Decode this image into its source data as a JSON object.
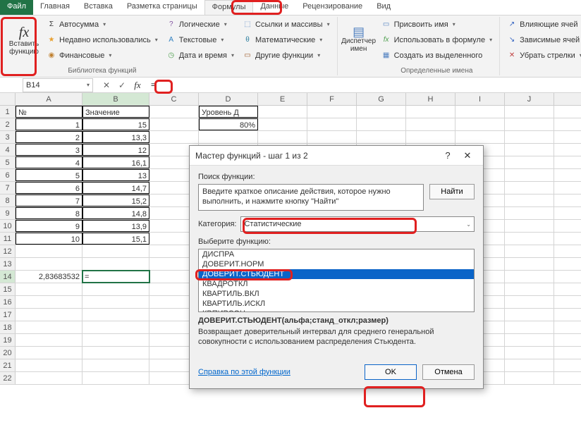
{
  "tabs": {
    "file": "Файл",
    "home": "Главная",
    "insert": "Вставка",
    "layout": "Разметка страницы",
    "formulas": "Формулы",
    "data": "Данные",
    "review": "Рецензирование",
    "view": "Вид"
  },
  "ribbon": {
    "insert_fn_label": "Вставить функцию",
    "autosum": "Автосумма",
    "recent": "Недавно использовались",
    "financial": "Финансовые",
    "logical": "Логические",
    "text": "Текстовые",
    "datetime": "Дата и время",
    "lookup": "Ссылки и массивы",
    "math": "Математические",
    "other": "Другие функции",
    "lib_label": "Библиотека функций",
    "name_mgr": "Диспетчер имен",
    "define_name": "Присвоить имя",
    "use_in_formula": "Использовать в формуле",
    "create_from_sel": "Создать из выделенного",
    "names_label": "Определенные имена",
    "trace_prec": "Влияющие ячей",
    "trace_dep": "Зависимые ячей",
    "remove_arrows": "Убрать стрелки"
  },
  "namebox": "B14",
  "formula_bar_value": "=",
  "columns": [
    "A",
    "B",
    "C",
    "D",
    "E",
    "F",
    "G",
    "H",
    "I",
    "J"
  ],
  "grid": {
    "a1": "№",
    "b1": "Значение",
    "d1": "Уровень Д",
    "d2": "80%",
    "rows": [
      {
        "n": "1",
        "v": "15"
      },
      {
        "n": "2",
        "v": "13,3"
      },
      {
        "n": "3",
        "v": "12"
      },
      {
        "n": "4",
        "v": "16,1"
      },
      {
        "n": "5",
        "v": "13"
      },
      {
        "n": "6",
        "v": "14,7"
      },
      {
        "n": "7",
        "v": "15,2"
      },
      {
        "n": "8",
        "v": "14,8"
      },
      {
        "n": "9",
        "v": "13,9"
      },
      {
        "n": "10",
        "v": "15,1"
      }
    ],
    "a14": "2,83683532",
    "b14": "="
  },
  "dialog": {
    "title": "Мастер функций - шаг 1 из 2",
    "search_label": "Поиск функции:",
    "search_text": "Введите краткое описание действия, которое нужно выполнить, и нажмите кнопку \"Найти\"",
    "find_btn": "Найти",
    "category_label": "Категория:",
    "category_value": "Статистические",
    "select_label": "Выберите функцию:",
    "functions": [
      "ДИСПРА",
      "ДОВЕРИТ.НОРМ",
      "ДОВЕРИТ.СТЬЮДЕНТ",
      "КВАДРОТКЛ",
      "КВАРТИЛЬ.ВКЛ",
      "КВАРТИЛЬ.ИСКЛ",
      "КВПИРСОН"
    ],
    "selected_index": 2,
    "signature": "ДОВЕРИТ.СТЬЮДЕНТ(альфа;станд_откл;размер)",
    "description": "Возвращает доверительный интервал для среднего генеральной совокупности с использованием распределения Стьюдента.",
    "help_link": "Справка по этой функции",
    "ok": "OK",
    "cancel": "Отмена"
  }
}
